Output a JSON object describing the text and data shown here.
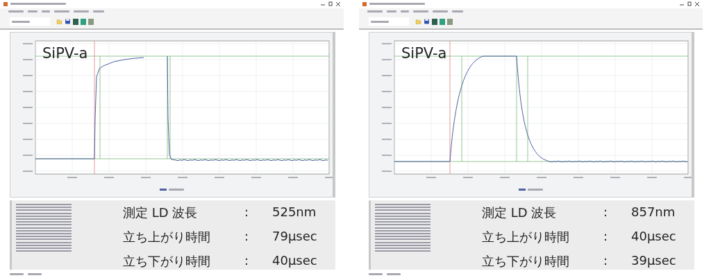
{
  "windows": [
    {
      "trace": {
        "kind": "slow_rise"
      },
      "chart_label": "SiPV-a",
      "measurements": [
        {
          "name": "測定 LD 波長",
          "separator": ":",
          "value": "525nm"
        },
        {
          "name": "立ち上がり時間",
          "separator": ":",
          "value": "79μsec"
        },
        {
          "name": "立ち下がり時間",
          "separator": ":",
          "value": "40μsec"
        }
      ]
    },
    {
      "trace": {
        "kind": "smooth_pulse"
      },
      "chart_label": "SiPV-a",
      "measurements": [
        {
          "name": "測定 LD 波長",
          "separator": ":",
          "value": "857nm"
        },
        {
          "name": "立ち上がり時間",
          "separator": ":",
          "value": "40μsec"
        },
        {
          "name": "立ち下がり時間",
          "separator": ":",
          "value": "39μsec"
        }
      ]
    }
  ]
}
